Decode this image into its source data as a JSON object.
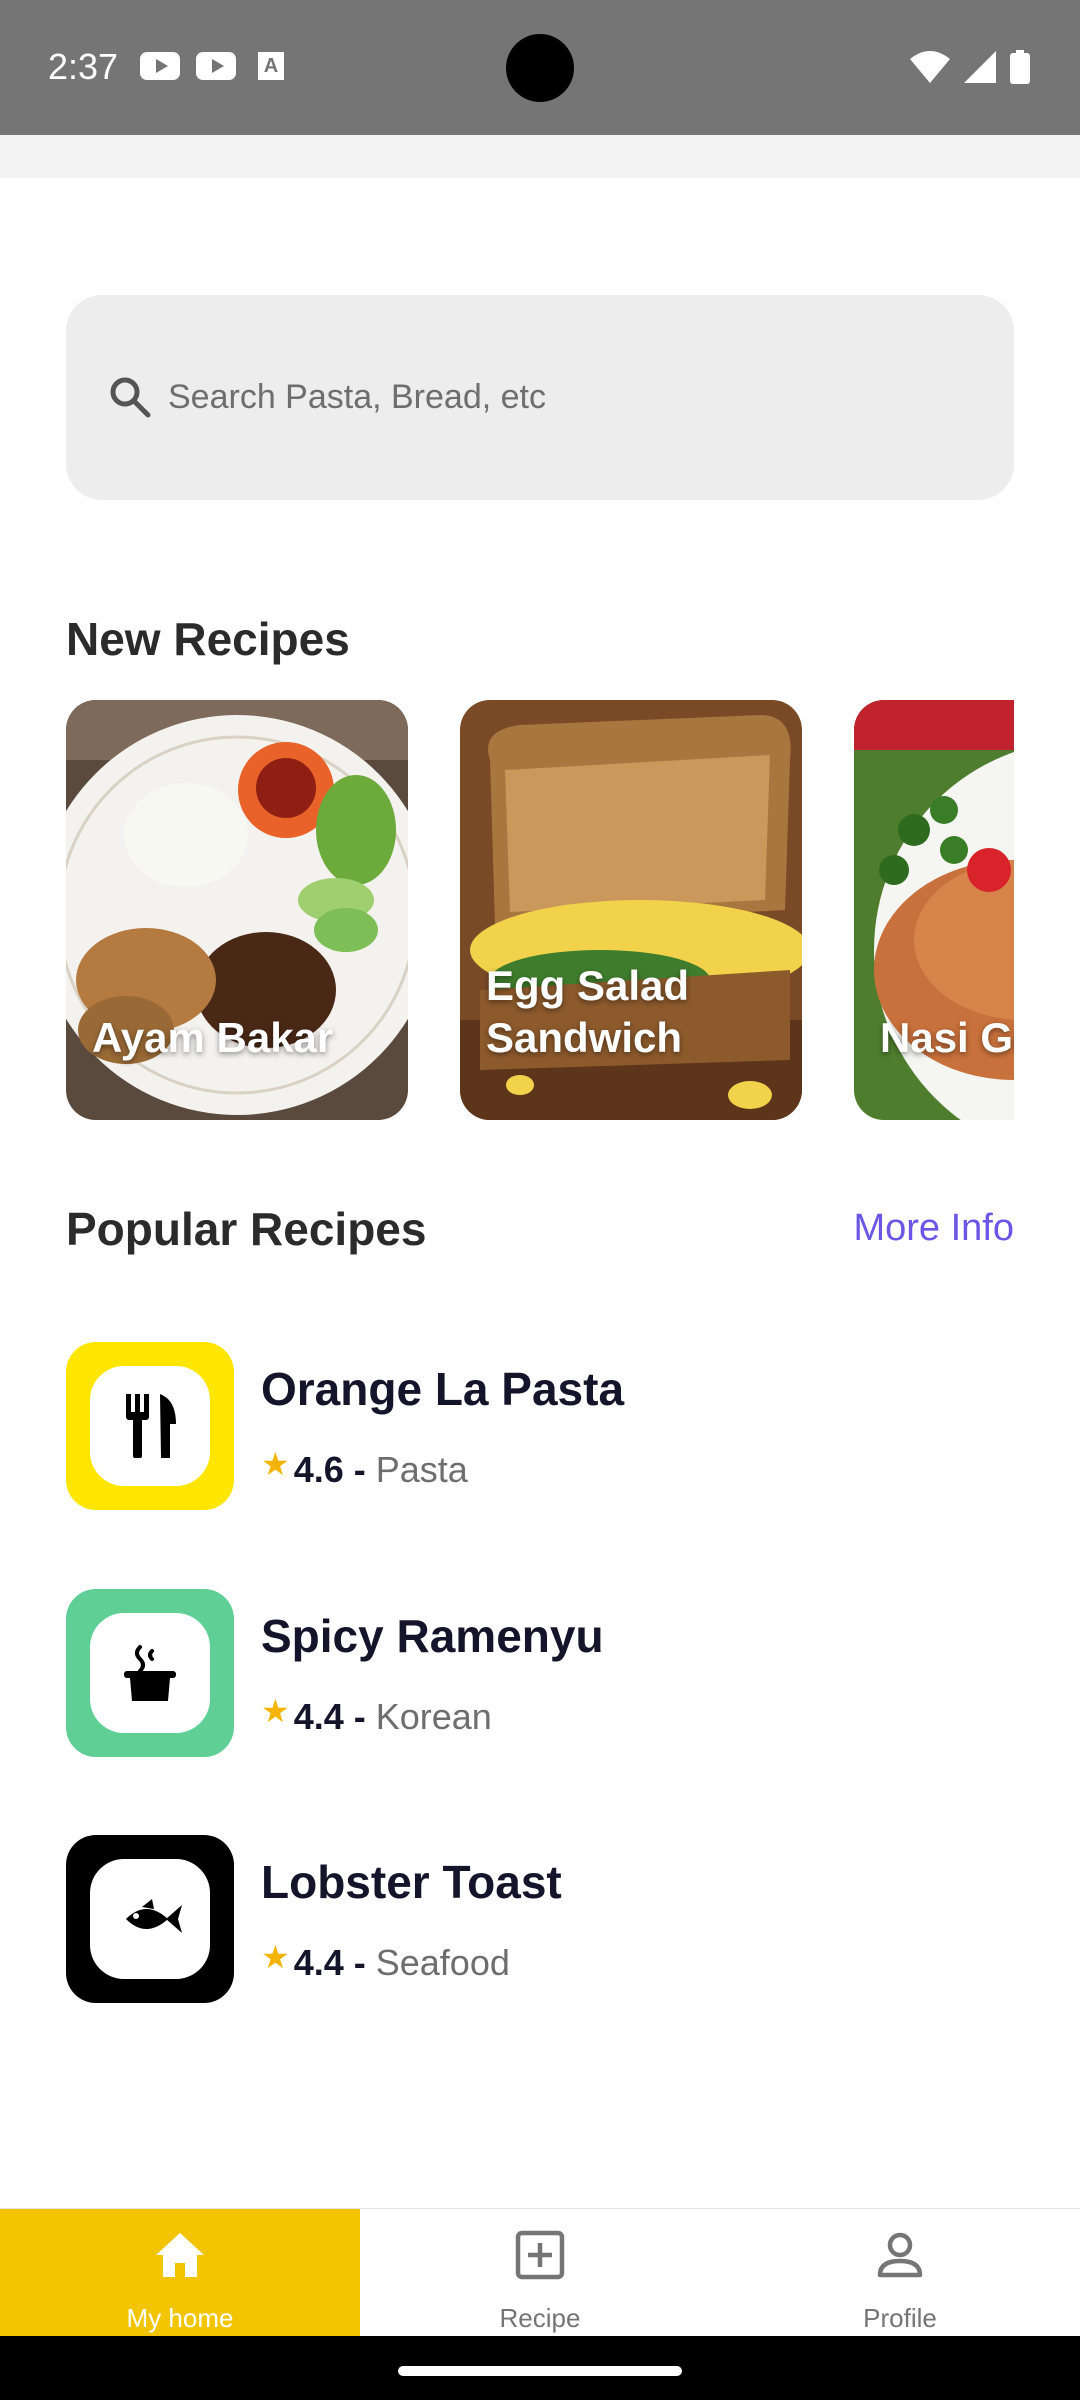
{
  "status_bar": {
    "time": "2:37"
  },
  "search": {
    "placeholder": "Search Pasta, Bread, etc"
  },
  "new_recipes": {
    "title": "New Recipes",
    "cards": [
      {
        "label": "Ayam Bakar"
      },
      {
        "label": "Egg Salad\nSandwich"
      },
      {
        "label": "Nasi Goreng"
      }
    ]
  },
  "popular_recipes": {
    "title": "Popular Recipes",
    "more_label": "More Info",
    "items": [
      {
        "name": "Orange La Pasta",
        "rating": "4.6",
        "separator": "-",
        "category": "Pasta",
        "icon": "fork-knife-icon",
        "icon_bg": "#ffe600"
      },
      {
        "name": "Spicy Ramenyu",
        "rating": "4.4",
        "separator": "-",
        "category": "Korean",
        "icon": "steaming-pot-icon",
        "icon_bg": "#5fcf96"
      },
      {
        "name": "Lobster Toast",
        "rating": "4.4",
        "separator": "-",
        "category": "Seafood",
        "icon": "fish-icon",
        "icon_bg": "#000000"
      }
    ]
  },
  "bottom_nav": {
    "items": [
      {
        "label": "My home",
        "icon": "home-icon",
        "active": true
      },
      {
        "label": "Recipe",
        "icon": "add-box-icon",
        "active": false
      },
      {
        "label": "Profile",
        "icon": "person-icon",
        "active": false
      }
    ]
  },
  "colors": {
    "accent": "#f2c500",
    "link": "#6b57e6",
    "star": "#f5b400"
  }
}
